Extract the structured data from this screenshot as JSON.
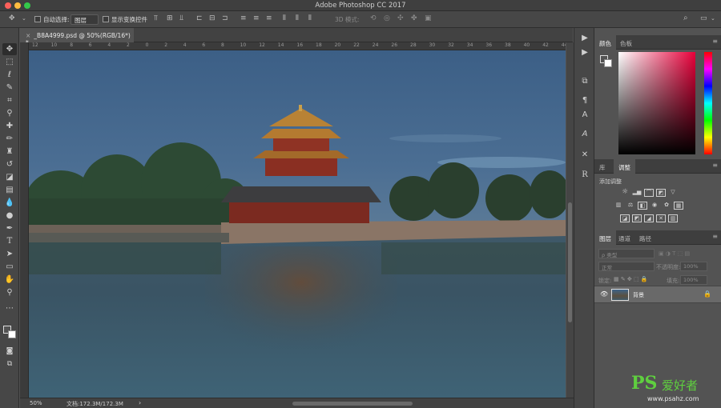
{
  "window": {
    "title": "Adobe Photoshop CC 2017"
  },
  "options": {
    "auto_select_label": "自动选择:",
    "auto_select_value": "图层",
    "transform_label": "显示变换控件",
    "mode3d_label": "3D 模式:"
  },
  "document": {
    "tab_label": "_B8A4999.psd @ 50%(RGB/16*) *",
    "close_glyph": "×"
  },
  "ruler": {
    "h_ticks": [
      "12",
      "10",
      "8",
      "6",
      "4",
      "2",
      "0",
      "2",
      "4",
      "6",
      "8",
      "10",
      "12",
      "14",
      "16",
      "18",
      "20",
      "22",
      "24",
      "26",
      "28",
      "30",
      "32",
      "34",
      "36",
      "38",
      "40",
      "42",
      "44",
      "46"
    ]
  },
  "status": {
    "zoom": "50%",
    "doc_size": "文档:172.3M/172.3M",
    "arrow": "›"
  },
  "color_panel": {
    "tabs": [
      "颜色",
      "色板"
    ]
  },
  "adjust_panel": {
    "tabs": [
      "库",
      "调整"
    ],
    "title": "添加调整"
  },
  "layers_panel": {
    "tabs": [
      "图层",
      "通道",
      "路径"
    ],
    "filter_placeholder": "ρ 类型",
    "blend_mode": "正常",
    "opacity_label": "不透明度:",
    "opacity_value": "100%",
    "lock_label": "锁定:",
    "fill_label": "填充:",
    "fill_value": "100%",
    "layers": [
      {
        "name": "背景",
        "visible": true,
        "locked": true
      }
    ]
  },
  "watermark": {
    "logo": "PS",
    "text": "爱好者",
    "url": "www.psahz.com"
  },
  "colors": {
    "accent": "#2d8fe0",
    "panel": "#535353",
    "dark": "#474747"
  }
}
